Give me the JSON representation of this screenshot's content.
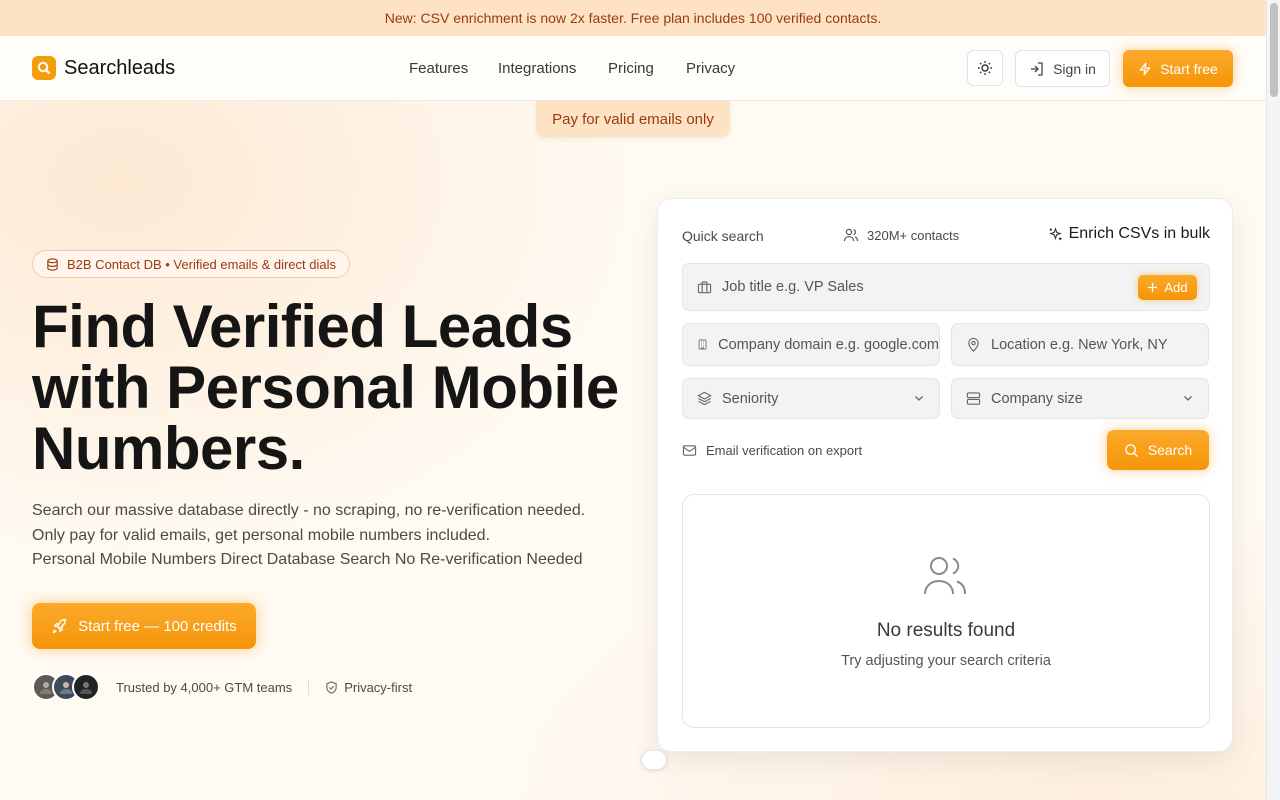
{
  "announcement": "New: CSV enrichment is now 2x faster. Free plan includes 100 verified contacts.",
  "brand": {
    "name": "Searchleads",
    "accent": "#f59e0b"
  },
  "nav": {
    "features": "Features",
    "integrations": "Integrations",
    "pricing": "Pricing",
    "privacy": "Privacy"
  },
  "header": {
    "sign_in": "Sign in",
    "start_free": "Start free"
  },
  "hero": {
    "pill": "Pay for valid emails only",
    "badge": "B2B Contact DB • Verified emails & direct dials",
    "title_line1": "Find Verified Leads",
    "title_line2": "with Personal Mobile",
    "title_line3": "Numbers.",
    "sub_line1": "Search our massive database directly - no scraping, no re-verification needed.",
    "sub_line2": "Only pay for valid emails, get personal mobile numbers included.",
    "sub_line3": "Personal Mobile Numbers Direct Database Search No Re-verification Needed",
    "cta": "Start free — 100 credits",
    "trusted": "Trusted by 4,000+ GTM teams",
    "privacy_first": "Privacy-first"
  },
  "search_card": {
    "label": "Quick search",
    "contacts": "320M+ contacts",
    "enrich": "Enrich CSVs in bulk",
    "job_placeholder": "Job title e.g. VP Sales",
    "add": "Add",
    "domain_placeholder": "Company domain e.g. google.com",
    "location_placeholder": "Location e.g. New York, NY",
    "seniority": "Seniority",
    "company_size": "Company size",
    "verification": "Email verification on export",
    "search": "Search",
    "empty_title": "No results found",
    "empty_sub": "Try adjusting your search criteria"
  }
}
